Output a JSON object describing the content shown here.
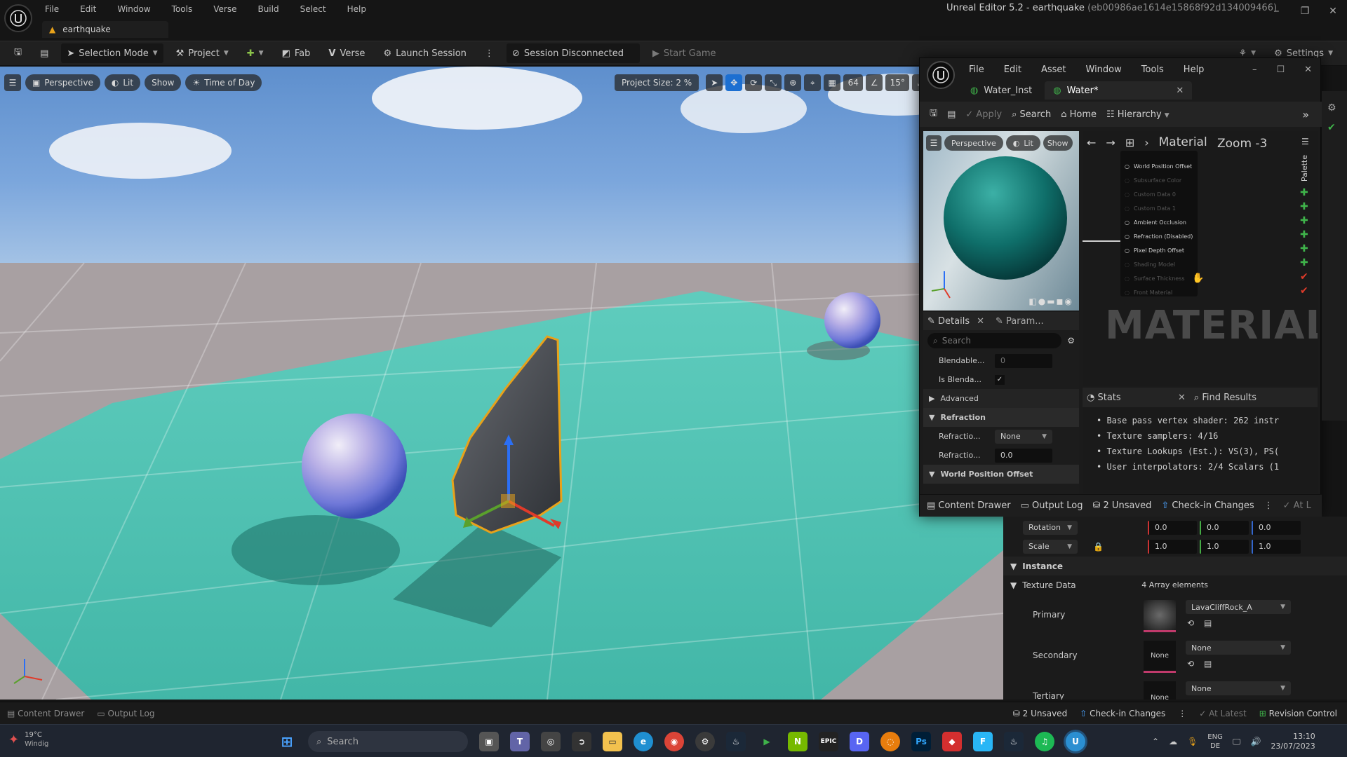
{
  "menu": [
    "File",
    "Edit",
    "Window",
    "Tools",
    "Verse",
    "Build",
    "Select",
    "Help"
  ],
  "project_tab": "earthquake",
  "window_title": "Unreal Editor 5.2 - earthquake",
  "window_hash": "(eb00986ae1614e15868f92d134009466)",
  "toolbar": {
    "selection_mode": "Selection Mode",
    "project": "Project",
    "fab": "Fab",
    "verse": "Verse",
    "launch_session": "Launch Session",
    "session_status": "Session Disconnected",
    "start_game": "Start Game",
    "settings": "Settings"
  },
  "viewport": {
    "perspective": "Perspective",
    "lit": "Lit",
    "show": "Show",
    "time_of_day": "Time of Day",
    "project_size": "Project Size: 2 %",
    "grid_value": "64",
    "angle_value": "15°"
  },
  "material_editor": {
    "menu": [
      "File",
      "Edit",
      "Asset",
      "Window",
      "Tools",
      "Help"
    ],
    "tab_inst": "Water_Inst",
    "tab_water": "Water*",
    "toolbar": {
      "apply": "Apply",
      "search": "Search",
      "home": "Home",
      "hierarchy": "Hierarchy"
    },
    "preview": {
      "perspective": "Perspective",
      "lit": "Lit",
      "show": "Show"
    },
    "graph": {
      "breadcrumb": "Material",
      "zoom": "Zoom -3",
      "watermark": "MATERIAL",
      "palette": "Palette",
      "pins": [
        {
          "label": "World Position Offset",
          "active": true
        },
        {
          "label": "Subsurface Color",
          "active": false
        },
        {
          "label": "Custom Data 0",
          "active": false
        },
        {
          "label": "Custom Data 1",
          "active": false
        },
        {
          "label": "Ambient Occlusion",
          "active": true
        },
        {
          "label": "Refraction (Disabled)",
          "active": true
        },
        {
          "label": "Pixel Depth Offset",
          "active": true
        },
        {
          "label": "Shading Model",
          "active": false
        },
        {
          "label": "Surface Thickness",
          "active": false
        },
        {
          "label": "Front Material",
          "active": false
        }
      ]
    },
    "details": {
      "tab": "Details",
      "tab2": "Param...",
      "search_placeholder": "Search",
      "blendable_label": "Blendable...",
      "blendable_value": "0",
      "is_blendable_label": "Is Blenda...",
      "advanced": "Advanced",
      "refraction": "Refraction",
      "refraction_mode_label": "Refractio...",
      "refraction_mode_value": "None",
      "refraction_value_label": "Refractio...",
      "refraction_value": "0.0",
      "world_position_offset": "World Position Offset"
    },
    "stats": {
      "tab": "Stats",
      "find_results": "Find Results",
      "lines": [
        "Base pass vertex shader: 262 instr",
        "Texture samplers: 4/16",
        "Texture Lookups (Est.): VS(3), PS(",
        "User interpolators: 2/4 Scalars (1"
      ]
    },
    "bottom": {
      "content_drawer": "Content Drawer",
      "output_log": "Output Log",
      "unsaved": "2 Unsaved",
      "check_in": "Check-in Changes",
      "at_latest": "At L"
    }
  },
  "details_panel": {
    "rotation_label": "Rotation",
    "rotation": [
      "0.0",
      "0.0",
      "0.0"
    ],
    "scale_label": "Scale",
    "scale": [
      "1.0",
      "1.0",
      "1.0"
    ],
    "instance": "Instance",
    "texture_data": "Texture Data",
    "array_count": "4 Array elements",
    "primary_label": "Primary",
    "primary_value": "LavaCliffRock_A",
    "secondary_label": "Secondary",
    "secondary_value": "None",
    "secondary_thumb": "None",
    "tertiary_label": "Tertiary",
    "tertiary_value": "None",
    "tertiary_thumb": "None"
  },
  "statusbar": {
    "content_drawer": "Content Drawer",
    "output_log": "Output Log",
    "unsaved": "2 Unsaved",
    "check_in": "Check-in Changes",
    "at_latest": "At Latest",
    "revision_control": "Revision Control"
  },
  "taskbar": {
    "weather_temp": "19°C",
    "weather_desc": "Windig",
    "search_placeholder": "Search",
    "lang_line1": "ENG",
    "lang_line2": "DE",
    "time": "13:10",
    "date": "23/07/2023"
  },
  "colors": {
    "accent_blue": "#1c6fd1",
    "selection_orange": "#e8a21a",
    "water_teal": "#46c9b8",
    "sphere_teal": "#0f6f6a"
  }
}
